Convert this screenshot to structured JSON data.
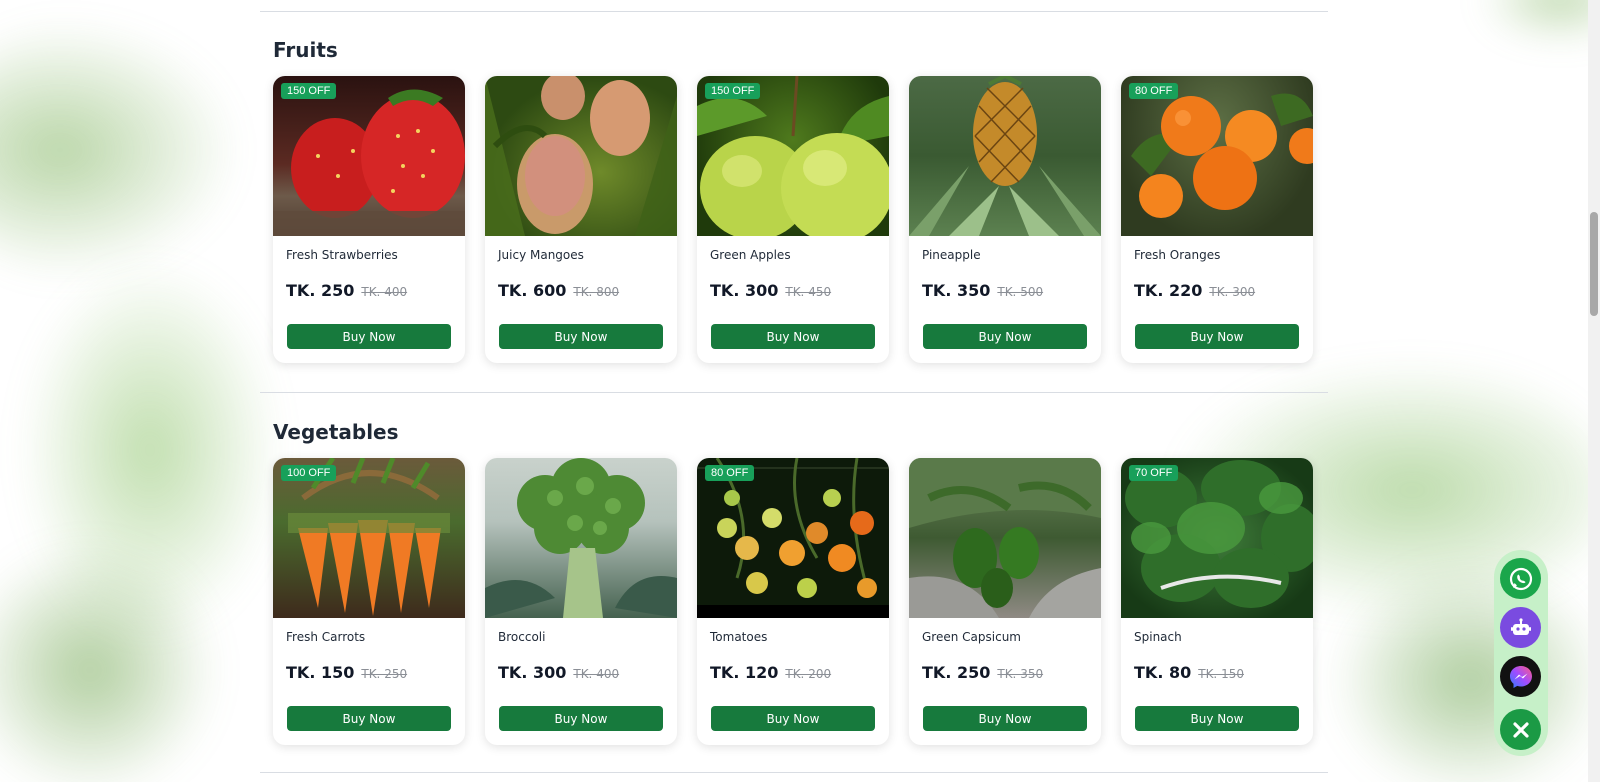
{
  "sections": [
    {
      "title": "Fruits",
      "products": [
        {
          "name": "Fresh Strawberries",
          "price": "TK. 250",
          "old_price": "TK. 400",
          "badge": "150 OFF",
          "button": "Buy Now"
        },
        {
          "name": "Juicy Mangoes",
          "price": "TK. 600",
          "old_price": "TK. 800",
          "badge": "",
          "button": "Buy Now"
        },
        {
          "name": "Green Apples",
          "price": "TK. 300",
          "old_price": "TK. 450",
          "badge": "150 OFF",
          "button": "Buy Now"
        },
        {
          "name": "Pineapple",
          "price": "TK. 350",
          "old_price": "TK. 500",
          "badge": "",
          "button": "Buy Now"
        },
        {
          "name": "Fresh Oranges",
          "price": "TK. 220",
          "old_price": "TK. 300",
          "badge": "80 OFF",
          "button": "Buy Now"
        }
      ]
    },
    {
      "title": "Vegetables",
      "products": [
        {
          "name": "Fresh Carrots",
          "price": "TK. 150",
          "old_price": "TK. 250",
          "badge": "100 OFF",
          "button": "Buy Now"
        },
        {
          "name": "Broccoli",
          "price": "TK. 300",
          "old_price": "TK. 400",
          "badge": "",
          "button": "Buy Now"
        },
        {
          "name": "Tomatoes",
          "price": "TK. 120",
          "old_price": "TK. 200",
          "badge": "80 OFF",
          "button": "Buy Now"
        },
        {
          "name": "Green Capsicum",
          "price": "TK. 250",
          "old_price": "TK. 350",
          "badge": "",
          "button": "Buy Now"
        },
        {
          "name": "Spinach",
          "price": "TK. 80",
          "old_price": "TK. 150",
          "badge": "70 OFF",
          "button": "Buy Now"
        }
      ]
    }
  ],
  "floating_actions": {
    "whatsapp": "whatsapp-icon",
    "bot": "robot-icon",
    "messenger": "messenger-icon",
    "close": "close-icon"
  },
  "colors": {
    "accent": "#177a3d",
    "badge": "#18a05a",
    "fab_rail": "#c6f0c8",
    "bot": "#7a4be0"
  }
}
